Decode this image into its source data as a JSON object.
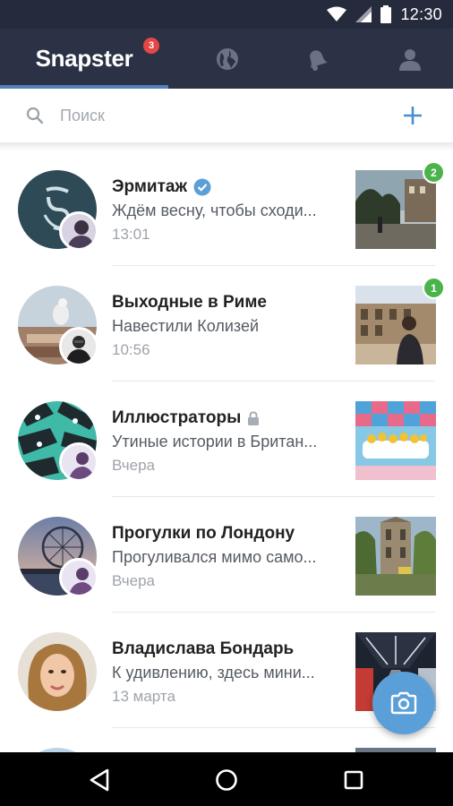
{
  "status_bar": {
    "time": "12:30"
  },
  "header": {
    "title": "Snapster",
    "badge": "3",
    "tabs": [
      "home",
      "globe-icon",
      "bell-icon",
      "profile-icon"
    ]
  },
  "search": {
    "placeholder": "Поиск"
  },
  "chats": [
    {
      "name": "Эрмитаж",
      "message": "Ждём весну, чтобы сходи...",
      "time": "13:01",
      "verified": true,
      "unread": "2"
    },
    {
      "name": "Выходные в Риме",
      "message": "Навестили Колизей",
      "time": "10:56",
      "unread": "1"
    },
    {
      "name": "Иллюстраторы",
      "message": "Утиные истории в Британ...",
      "time": "Вчера",
      "locked": true
    },
    {
      "name": "Прогулки по Лондону",
      "message": "Прогуливался мимо само...",
      "time": "Вчера"
    },
    {
      "name": "Владислава Бондарь",
      "message": "К удивлению, здесь мини...",
      "time": "13 марта"
    }
  ],
  "colors": {
    "header": "#2b3245",
    "accent": "#5181b8",
    "badge": "#e64646",
    "unread": "#4bb34b",
    "fab": "#5b9fd9"
  },
  "icons": [
    "wifi-icon",
    "signal-icon",
    "battery-icon",
    "search-icon",
    "plus-icon",
    "verified-icon",
    "lock-icon",
    "camera-icon",
    "back-icon",
    "home-icon",
    "recents-icon"
  ]
}
